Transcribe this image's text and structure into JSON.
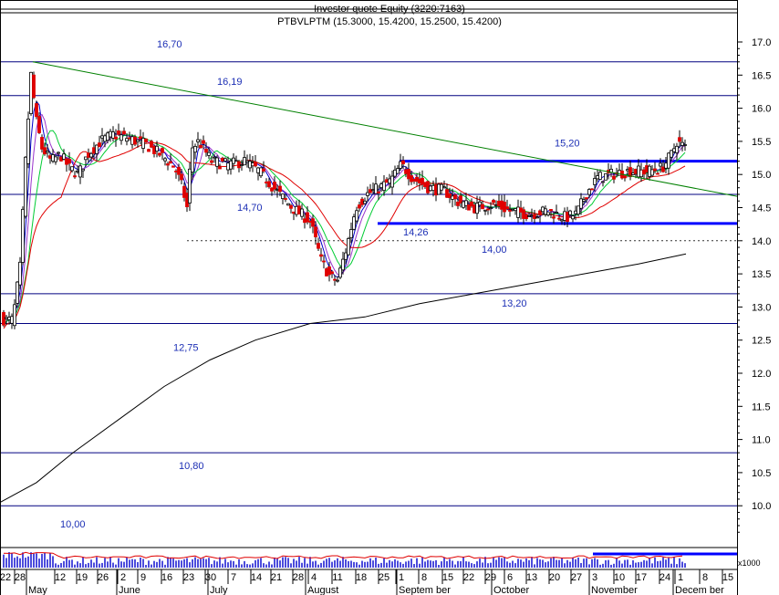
{
  "header": {
    "title": "Investor quote Equity (3220:7163)",
    "symbol_line": "PTBVLPTM (15.3000, 15.4200, 15.2500, 15.4200)"
  },
  "chart_data": {
    "type": "candlestick",
    "ylim": [
      9.85,
      17.35
    ],
    "y_ticks": [
      "17.0",
      "16.5",
      "16.0",
      "15.5",
      "15.0",
      "14.5",
      "14.0",
      "13.5",
      "13.0",
      "12.5",
      "12.0",
      "11.5",
      "11.0",
      "10.5",
      "10.0"
    ],
    "volume_axis_label": "x1000",
    "x_tick_labels": [
      "22",
      "28",
      "12",
      "19",
      "26",
      "2",
      "9",
      "16",
      "23",
      "30",
      "7",
      "14",
      "21",
      "28",
      "4",
      "11",
      "18",
      "25",
      "1",
      "8",
      "15",
      "22",
      "29",
      "6",
      "13",
      "20",
      "27",
      "3",
      "10",
      "17",
      "24",
      "1",
      "8",
      "15"
    ],
    "month_labels": [
      "May",
      "June",
      "July",
      "August",
      "Septem ber",
      "October",
      "November",
      "Decem ber"
    ],
    "support_resistance": [
      {
        "value": 16.7,
        "label": "16,70"
      },
      {
        "value": 16.19,
        "label": "16,19"
      },
      {
        "value": 15.2,
        "label": "15,20"
      },
      {
        "value": 14.7,
        "label": "14,70"
      },
      {
        "value": 14.26,
        "label": "14,26"
      },
      {
        "value": 14.0,
        "label": "14,00"
      },
      {
        "value": 13.2,
        "label": "13,20"
      },
      {
        "value": 12.75,
        "label": "12,75"
      },
      {
        "value": 10.8,
        "label": "10,80"
      },
      {
        "value": 10.0,
        "label": "10,00"
      }
    ],
    "colors": {
      "grid": "#000080",
      "support_label": "#1c2fb5",
      "highlight_line": "#0000ff",
      "trend_line": "#008000",
      "ma_fast": "#0000cc",
      "ma_mid1": "#9933cc",
      "ma_mid2": "#00cc33",
      "ma_slow": "#e00000",
      "ma_long": "#000000",
      "candle_up": "#ffffff",
      "candle_down": "#e00000"
    }
  }
}
